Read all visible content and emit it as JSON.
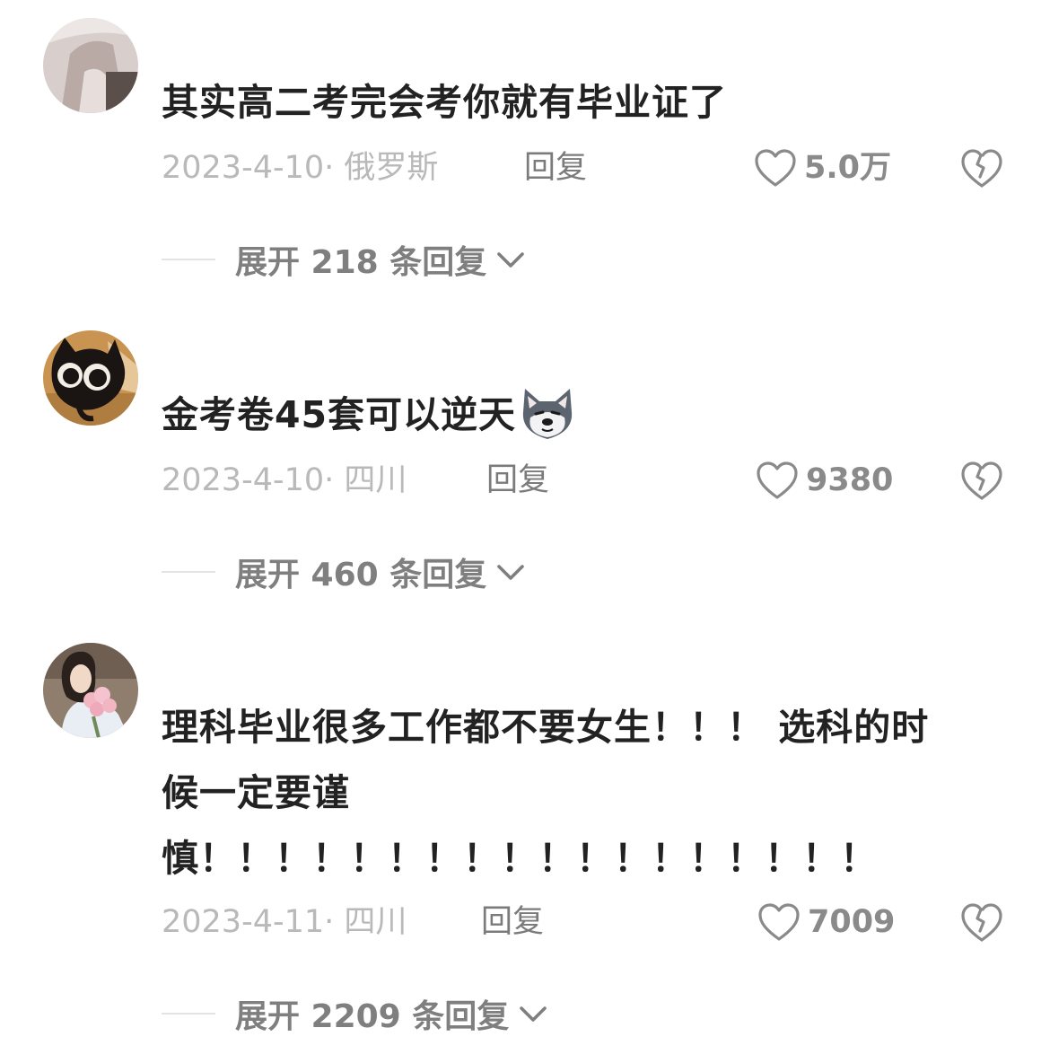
{
  "comments": [
    {
      "text_lines": [
        "其实高二考完会考你就有毕业证了"
      ],
      "date_location": "2023-4-10· 俄罗斯",
      "reply_label": "回复",
      "likes": "5.0万",
      "expand_label": "展开 218 条回复"
    },
    {
      "text_lines": [
        "金考卷45套可以逆天"
      ],
      "date_location": "2023-4-10· 四川",
      "reply_label": "回复",
      "likes": "9380",
      "expand_label": "展开 460 条回复",
      "emoji_icon": "husky-dog-emoji-icon"
    },
    {
      "text_lines": [
        "理科毕业很多工作都不要女生！！！ 选科的时",
        "候一定要谨",
        "慎！！！！！！！！！！！！！！！！！！"
      ],
      "date_location": "2023-4-11· 四川",
      "reply_label": "回复",
      "likes": "7009",
      "expand_label": "展开 2209 条回复"
    }
  ],
  "icons": {
    "like": "heart-outline-icon",
    "dislike": "broken-heart-icon",
    "expand": "chevron-down-icon"
  },
  "colors": {
    "text": "#222222",
    "meta_gray": "#b9b9b9",
    "reply_gray": "#7b7b7b",
    "icon_gray": "#8a8a8a"
  }
}
